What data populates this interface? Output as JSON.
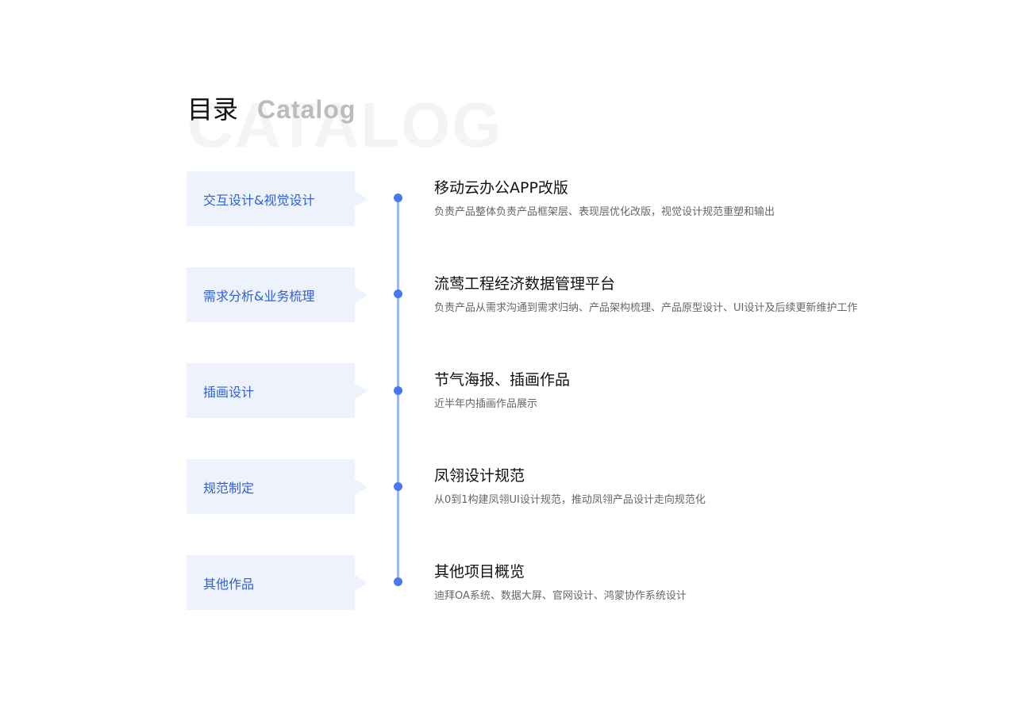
{
  "header": {
    "title_cn": "目录",
    "title_en": "Catalog",
    "watermark": "CATALOG"
  },
  "colors": {
    "accent": "#4a78ec",
    "line": "#9db5f6",
    "box_bg": "#edf2fd",
    "box_text": "#2f5fd9"
  },
  "items": [
    {
      "category": "交互设计&视觉设计",
      "title": "移动云办公APP改版",
      "desc": "负责产品整体负责产品框架层、表现层优化改版，视觉设计规范重塑和输出"
    },
    {
      "category": "需求分析&业务梳理",
      "title": "流莺工程经济数据管理平台",
      "desc": "负责产品从需求沟通到需求归纳、产品架构梳理、产品原型设计、UI设计及后续更新维护工作"
    },
    {
      "category": "插画设计",
      "title": "节气海报、插画作品",
      "desc": "近半年内插画作品展示"
    },
    {
      "category": "规范制定",
      "title": "凤翎设计规范",
      "desc": "从0到1构建凤翎UI设计规范，推动凤翎产品设计走向规范化"
    },
    {
      "category": "其他作品",
      "title": "其他项目概览",
      "desc": "迪拜OA系统、数据大屏、官网设计、鸿蒙协作系统设计"
    }
  ]
}
